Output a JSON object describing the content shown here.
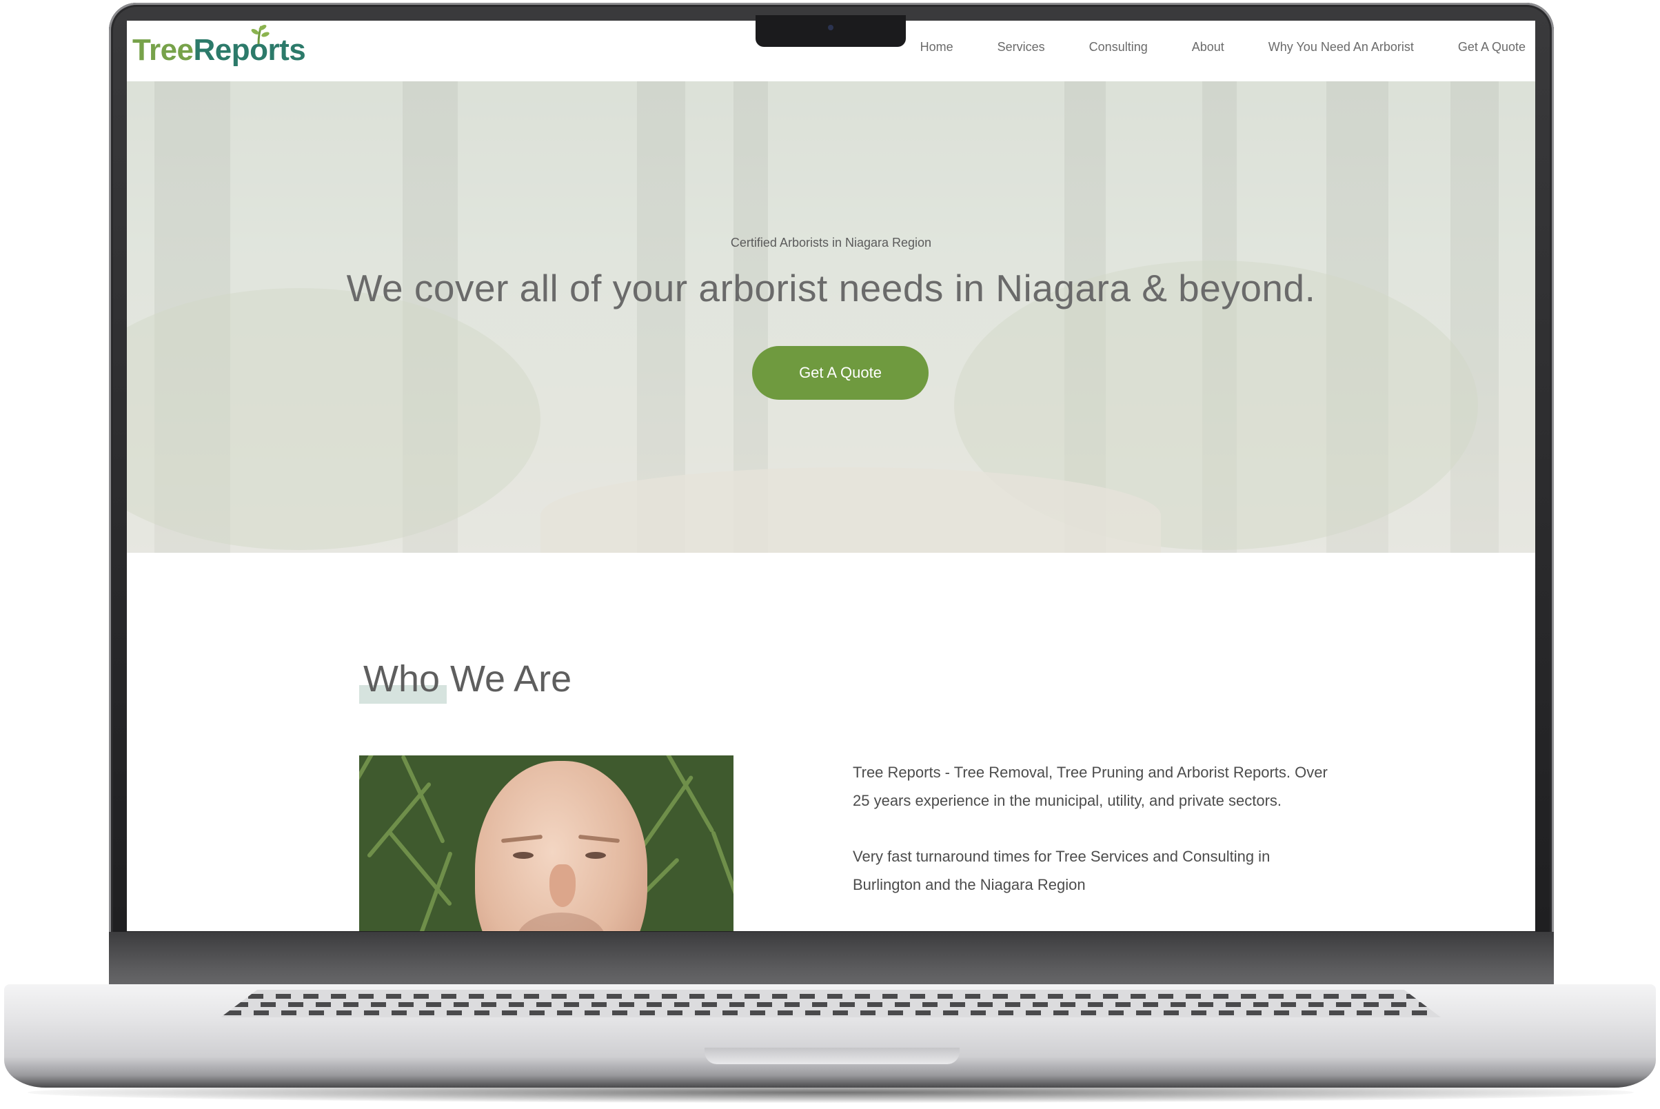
{
  "site": {
    "logo": {
      "part1": "Tree",
      "part2": "Reports"
    },
    "nav": [
      {
        "label": "Home"
      },
      {
        "label": "Services"
      },
      {
        "label": "Consulting"
      },
      {
        "label": "About"
      },
      {
        "label": "Why You Need An Arborist"
      },
      {
        "label": "Get A Quote"
      }
    ]
  },
  "hero": {
    "kicker": "Certified Arborists in Niagara Region",
    "title": "We cover all of your arborist needs in Niagara & beyond.",
    "button_label": "Get A Quote"
  },
  "who_we_are": {
    "title": "Who We Are",
    "paragraphs": [
      "Tree Reports - Tree Removal, Tree Pruning and Arborist Reports. Over 25 years experience in the municipal, utility, and private sectors.",
      "Very fast turnaround times for Tree Services and Consulting in Burlington and the Niagara Region"
    ]
  },
  "colors": {
    "brand_green": "#6f9a3f",
    "logo_teal": "#2c7a6a",
    "logo_green": "#77a24a"
  },
  "icons": {
    "logo_leaf": "leaf-sprig-icon"
  }
}
